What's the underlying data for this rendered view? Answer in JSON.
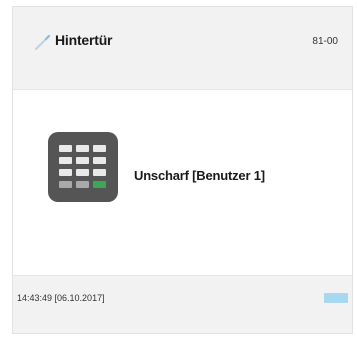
{
  "card": {
    "title": "Hintertür",
    "code": "81-00",
    "status": "Unscharf [Benutzer 1]",
    "timestamp": "14:43:49 [06.10.2017]"
  },
  "icons": {
    "title_icon": "pencil-icon",
    "status_icon": "keypad-icon",
    "footer_indicator": "status-indicator"
  },
  "colors": {
    "keypad_body": "#555555",
    "keypad_key": "#e9e9e9",
    "keypad_key_dim": "#a9a9a9",
    "keypad_key_active": "#3aa857",
    "indicator": "#a8d8f0"
  }
}
